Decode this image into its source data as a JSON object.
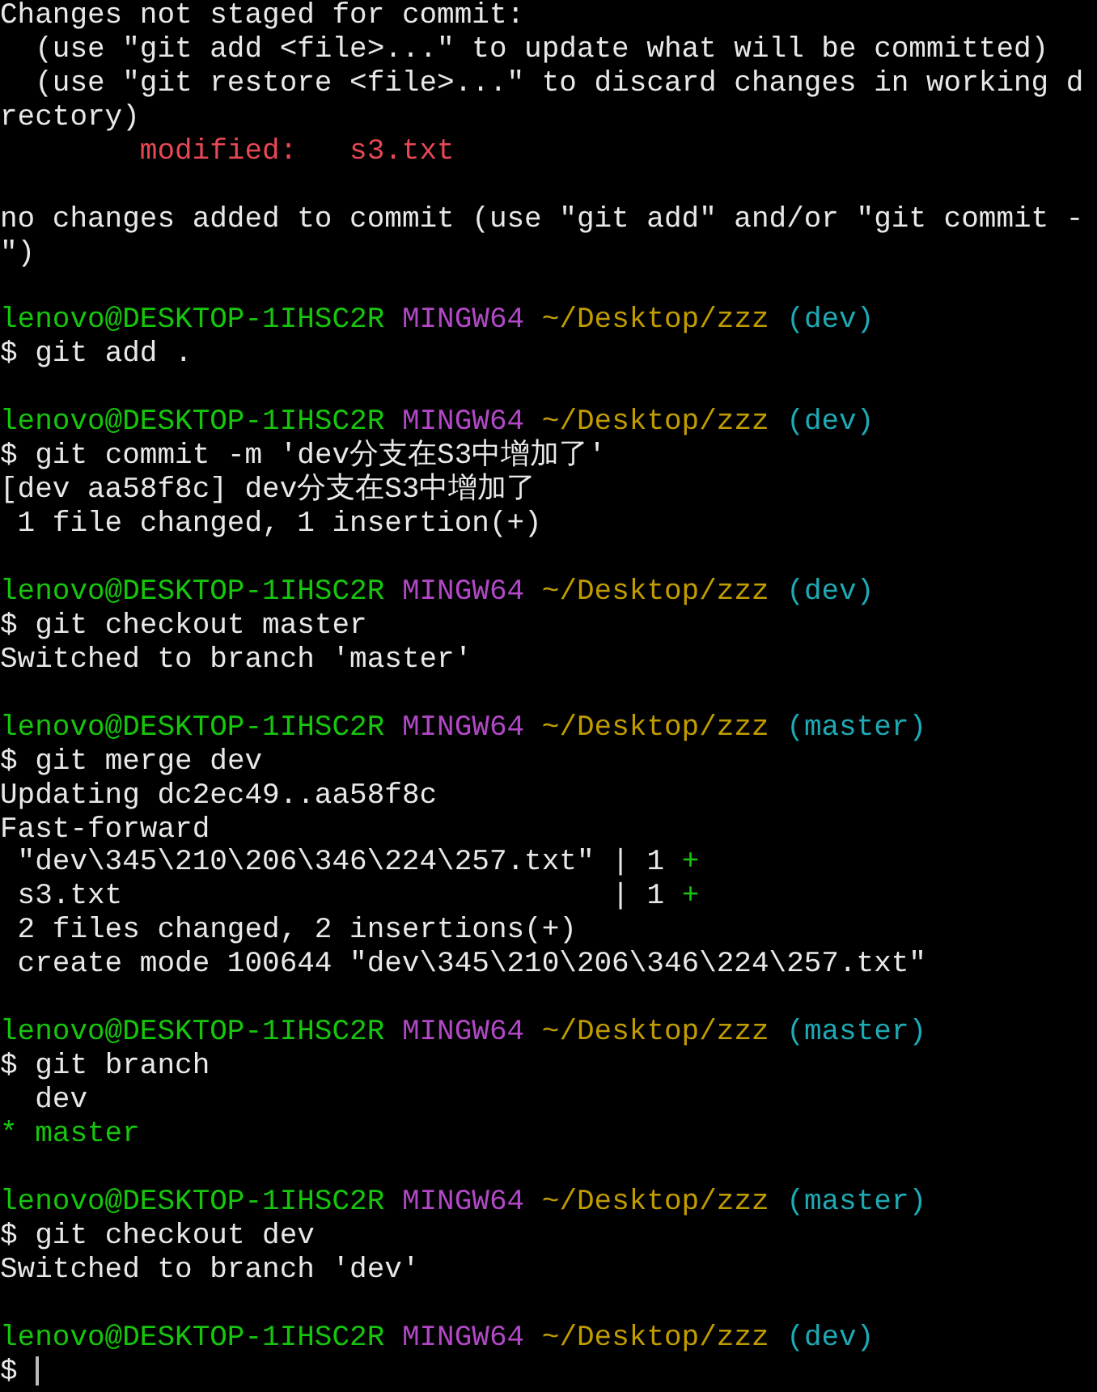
{
  "lines": [
    {
      "kind": "output",
      "text": "Changes not staged for commit:"
    },
    {
      "kind": "hint",
      "text": "(use \"git add <file>...\" to update what will be committed)"
    },
    {
      "kind": "hint",
      "text": "(use \"git restore <file>...\" to discard changes in working d"
    },
    {
      "kind": "output",
      "text": "rectory)"
    },
    {
      "kind": "status",
      "label": "modified:",
      "file": "s3.txt"
    },
    {
      "kind": "blank"
    },
    {
      "kind": "output",
      "text": "no changes added to commit (use \"git add\" and/or \"git commit -"
    },
    {
      "kind": "output",
      "text": "\")"
    },
    {
      "kind": "blank"
    },
    {
      "kind": "prompt",
      "user": "lenovo@DESKTOP-1IHSC2R",
      "shell": "MINGW64",
      "path": "~/Desktop/zzz",
      "branch": "(dev)"
    },
    {
      "kind": "command",
      "prompt": "$",
      "text": "git add ."
    },
    {
      "kind": "blank"
    },
    {
      "kind": "prompt",
      "user": "lenovo@DESKTOP-1IHSC2R",
      "shell": "MINGW64",
      "path": "~/Desktop/zzz",
      "branch": "(dev)"
    },
    {
      "kind": "command",
      "prompt": "$",
      "text": "git commit -m 'dev分支在S3中增加了'"
    },
    {
      "kind": "output",
      "text": "[dev aa58f8c] dev分支在S3中增加了"
    },
    {
      "kind": "summary",
      "text": "1 file changed, 1 insertion(+)"
    },
    {
      "kind": "blank"
    },
    {
      "kind": "prompt",
      "user": "lenovo@DESKTOP-1IHSC2R",
      "shell": "MINGW64",
      "path": "~/Desktop/zzz",
      "branch": "(dev)"
    },
    {
      "kind": "command",
      "prompt": "$",
      "text": "git checkout master"
    },
    {
      "kind": "output",
      "text": "Switched to branch 'master'"
    },
    {
      "kind": "blank"
    },
    {
      "kind": "prompt",
      "user": "lenovo@DESKTOP-1IHSC2R",
      "shell": "MINGW64",
      "path": "~/Desktop/zzz",
      "branch": "(master)"
    },
    {
      "kind": "command",
      "prompt": "$",
      "text": "git merge dev"
    },
    {
      "kind": "output",
      "text": "Updating dc2ec49..aa58f8c"
    },
    {
      "kind": "output",
      "text": "Fast-forward"
    },
    {
      "kind": "diffstat",
      "file": "\"dev\\345\\210\\206\\346\\224\\257.txt\"",
      "sep": "|",
      "count": "1",
      "plus": "+"
    },
    {
      "kind": "diffstat",
      "file": "s3.txt",
      "sep": "|",
      "count": "1",
      "plus": "+"
    },
    {
      "kind": "summary",
      "text": "2 files changed, 2 insertions(+)"
    },
    {
      "kind": "summary",
      "text": "create mode 100644 \"dev\\345\\210\\206\\346\\224\\257.txt\""
    },
    {
      "kind": "blank"
    },
    {
      "kind": "prompt",
      "user": "lenovo@DESKTOP-1IHSC2R",
      "shell": "MINGW64",
      "path": "~/Desktop/zzz",
      "branch": "(master)"
    },
    {
      "kind": "command",
      "prompt": "$",
      "text": "git branch"
    },
    {
      "kind": "branch",
      "name": "dev",
      "selected": false
    },
    {
      "kind": "branch",
      "marker": "*",
      "name": "master",
      "selected": true
    },
    {
      "kind": "blank"
    },
    {
      "kind": "prompt",
      "user": "lenovo@DESKTOP-1IHSC2R",
      "shell": "MINGW64",
      "path": "~/Desktop/zzz",
      "branch": "(master)"
    },
    {
      "kind": "command",
      "prompt": "$",
      "text": "git checkout dev"
    },
    {
      "kind": "output",
      "text": "Switched to branch 'dev'"
    },
    {
      "kind": "blank"
    },
    {
      "kind": "prompt",
      "user": "lenovo@DESKTOP-1IHSC2R",
      "shell": "MINGW64",
      "path": "~/Desktop/zzz",
      "branch": "(dev)"
    },
    {
      "kind": "cursor",
      "prompt": "$"
    }
  ]
}
